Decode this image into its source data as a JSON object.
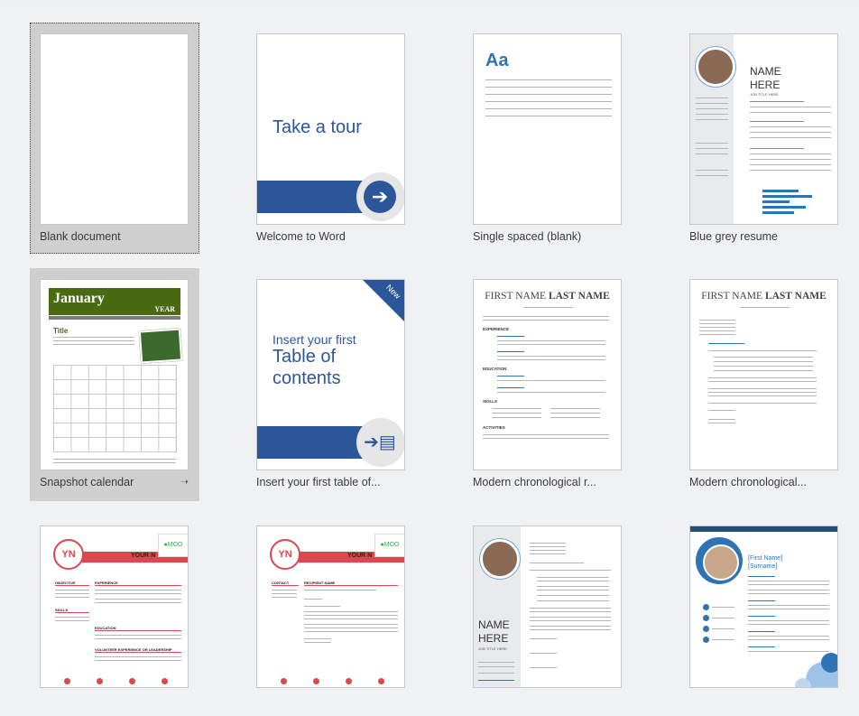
{
  "templates": [
    {
      "caption": "Blank document"
    },
    {
      "caption": "Welcome to Word",
      "tour_text": "Take a tour"
    },
    {
      "caption": "Single spaced (blank)",
      "aa": "Aa"
    },
    {
      "caption": "Blue grey resume",
      "name_line1": "NAME",
      "name_line2": "HERE",
      "job": "JOB TITLE HERE"
    },
    {
      "caption": "Snapshot calendar",
      "month": "January",
      "year": "YEAR",
      "title": "Title"
    },
    {
      "caption": "Insert your first table of...",
      "line1": "Insert your first",
      "line2": "Table of",
      "line3": "contents",
      "badge": "New"
    },
    {
      "caption": "Modern chronological r...",
      "first": "FIRST NAME ",
      "last": "LAST NAME",
      "sections": [
        "EXPERIENCE",
        "EDUCATION",
        "SKILLS",
        "ACTIVITIES"
      ]
    },
    {
      "caption": "Modern chronological...",
      "first": "FIRST NAME ",
      "last": "LAST NAME"
    },
    {
      "initials": "YN",
      "header": "YOUR N",
      "moo": "MOO",
      "sections": [
        "OBJECTIVE",
        "EXPERIENCE",
        "SKILLS",
        "EDUCATION",
        "VOLUNTEER EXPERIENCE OR LEADERSHIP"
      ]
    },
    {
      "initials": "YN",
      "header": "YOUR N",
      "moo": "MOO",
      "sections": [
        "CONTACT",
        "RECIPIENT NAME"
      ]
    },
    {
      "name_line1": "NAME",
      "name_line2": "HERE",
      "job": "JOB TITLE HERE"
    },
    {
      "name_line1": "[First Name]",
      "name_line2": "[Surname]"
    }
  ],
  "colors": {
    "accent_blue": "#2e74b5",
    "word_blue": "#2b579a",
    "calendar_green": "#4a6a12",
    "moo_red": "#e0474c",
    "moo_green": "#3aa655"
  }
}
